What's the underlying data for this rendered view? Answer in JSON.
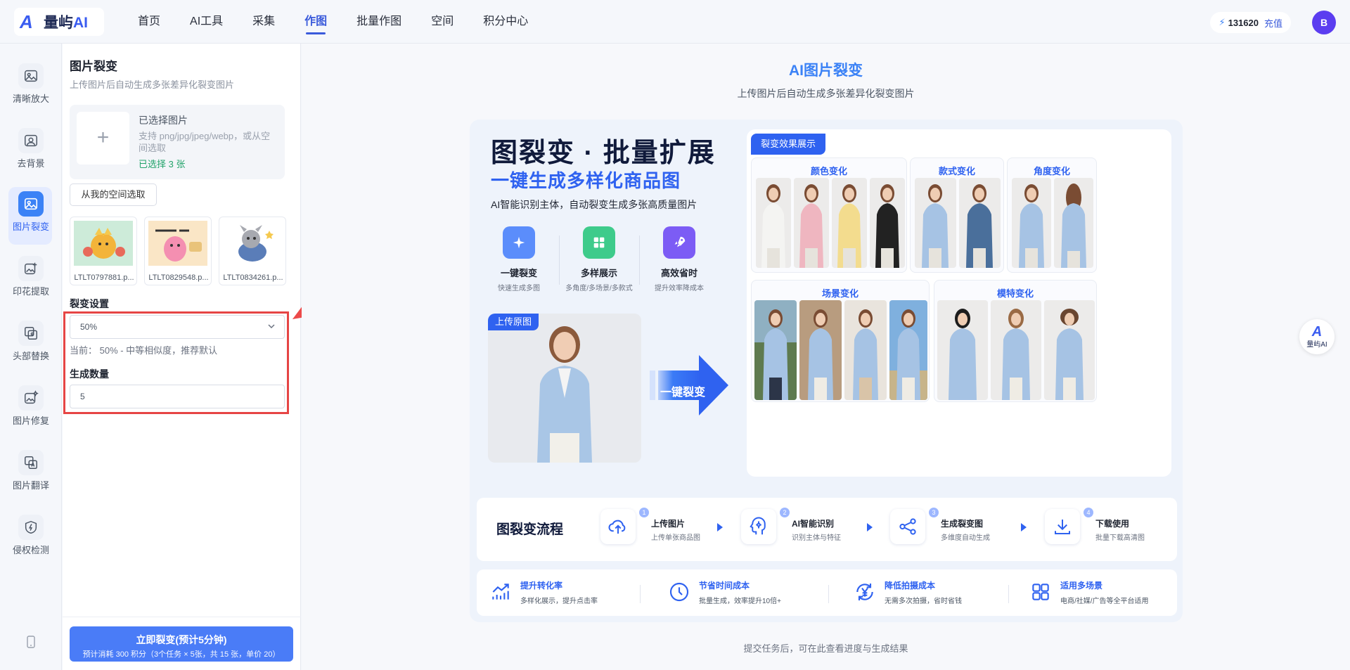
{
  "app": {
    "logo_text": "量屿",
    "logo_ai": "AI"
  },
  "nav": {
    "items": [
      {
        "label": "首页"
      },
      {
        "label": "AI工具"
      },
      {
        "label": "采集"
      },
      {
        "label": "作图",
        "active": true
      },
      {
        "label": "批量作图"
      },
      {
        "label": "空间"
      },
      {
        "label": "积分中心"
      }
    ],
    "credits": "131620",
    "charge_label": "充值",
    "avatar_letter": "B"
  },
  "rail": {
    "items": [
      {
        "label": "清晰放大",
        "icon": "upscale-icon"
      },
      {
        "label": "去背景",
        "icon": "remove-bg-icon"
      },
      {
        "label": "图片裂变",
        "icon": "image-fission-icon",
        "active": true
      },
      {
        "label": "印花提取",
        "icon": "print-extract-icon"
      },
      {
        "label": "头部替换",
        "icon": "head-swap-icon"
      },
      {
        "label": "图片修复",
        "icon": "image-repair-icon"
      },
      {
        "label": "图片翻译",
        "icon": "image-translate-icon"
      },
      {
        "label": "侵权检测",
        "icon": "infringement-icon"
      }
    ]
  },
  "panel": {
    "title": "图片裂变",
    "subtitle": "上传图片后自动生成多张差异化裂变图片",
    "upload": {
      "title": "已选择图片",
      "hint": "支持 png/jpg/jpeg/webp，或从空间选取",
      "selected": "已选择 3 张"
    },
    "space_button": "从我的空间选取",
    "thumbnails": [
      {
        "name": "LTLT0797881.p..."
      },
      {
        "name": "LTLT0829548.p..."
      },
      {
        "name": "LTLT0834261.p..."
      }
    ],
    "fission_label": "裂变设置",
    "fission_value": "50%",
    "current_text": "当前： 50% - 中等相似度，推荐默认",
    "quantity_label": "生成数量",
    "quantity_value": "5",
    "submit_title": "立即裂变(预计5分钟)",
    "submit_sub": "预计消耗 300 积分（3个任务 × 5张，共 15 张，单价 20）"
  },
  "main": {
    "title": "AI图片裂变",
    "subtitle": "上传图片后自动生成多张差异化裂变图片",
    "footer": "提交任务后，可在此查看进度与生成结果"
  },
  "poster": {
    "headline": "图裂变 · 批量扩展",
    "headline2": "一键生成多样化商品图",
    "desc": "AI智能识别主体，自动裂变生成多张高质量图片",
    "features": [
      {
        "title": "一键裂变",
        "sub": "快速生成多图",
        "color": "#5b8dfb"
      },
      {
        "title": "多样展示",
        "sub": "多角度/多场景/多款式",
        "color": "#3ecb8b"
      },
      {
        "title": "高效省时",
        "sub": "提升效率降成本",
        "color": "#7c5cf5"
      }
    ],
    "original_tag": "上传原图",
    "arrow_label": "一键裂变",
    "showcase_tag": "裂变效果展示",
    "cards": {
      "color": "颜色变化",
      "style": "款式变化",
      "angle": "角度变化",
      "scene": "场景变化",
      "model": "模特变化"
    },
    "flow": {
      "title": "图裂变流程",
      "steps": [
        {
          "num": "1",
          "title": "上传图片",
          "sub": "上传单张商品图"
        },
        {
          "num": "2",
          "title": "AI智能识别",
          "sub": "识别主体与特征"
        },
        {
          "num": "3",
          "title": "生成裂变图",
          "sub": "多维度自动生成"
        },
        {
          "num": "4",
          "title": "下载使用",
          "sub": "批量下载高清图"
        }
      ]
    },
    "benefits": [
      {
        "title": "提升转化率",
        "sub": "多样化展示，提升点击率"
      },
      {
        "title": "节省时间成本",
        "sub": "批量生成，效率提升10倍+"
      },
      {
        "title": "降低拍摄成本",
        "sub": "无需多次拍摄，省时省钱"
      },
      {
        "title": "适用多场景",
        "sub": "电商/社媒/广告等全平台适用"
      }
    ]
  },
  "float_logo": {
    "text": "量屿AI"
  }
}
